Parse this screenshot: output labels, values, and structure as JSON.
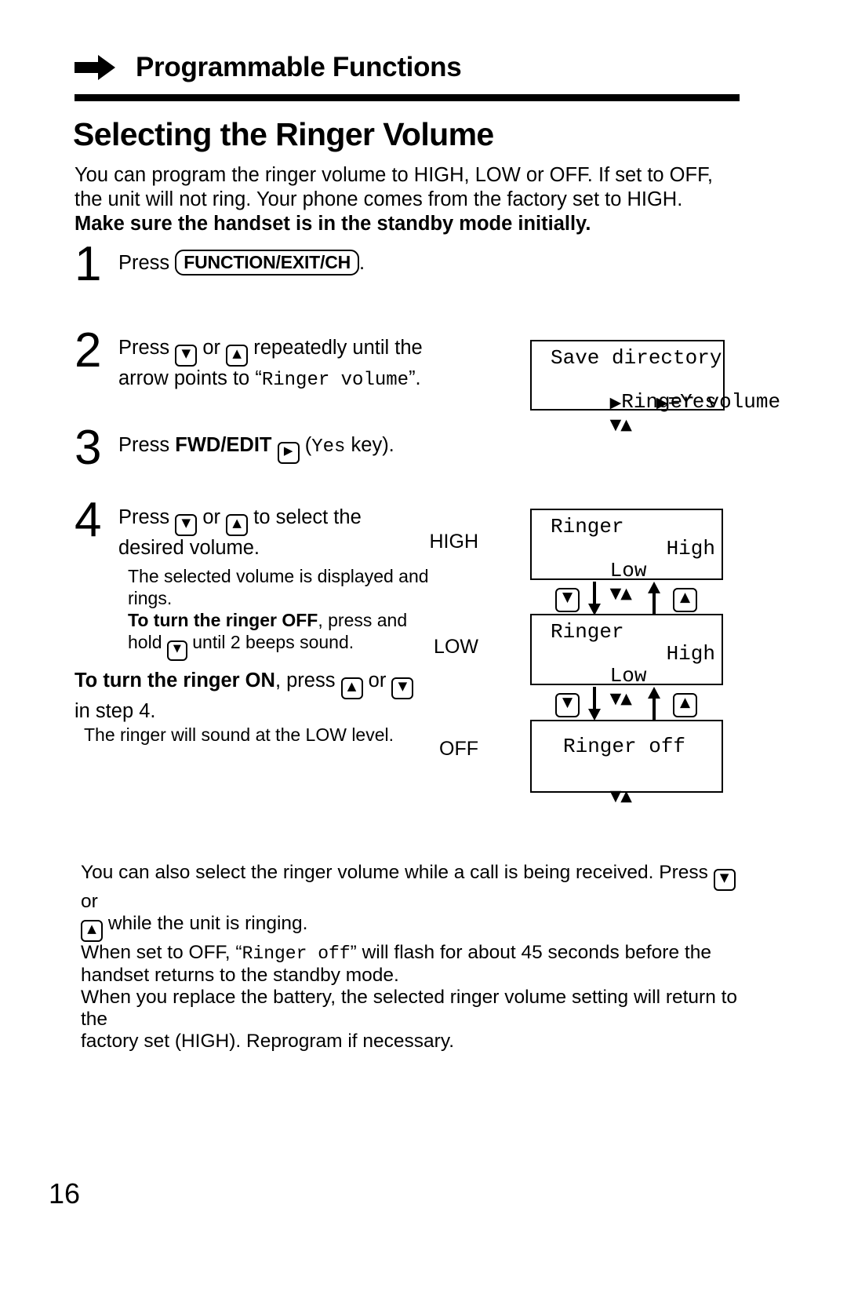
{
  "header": {
    "arrow_icon": "right-arrow-icon",
    "title": "Programmable Functions"
  },
  "section": {
    "title": "Selecting the Ringer Volume",
    "intro_line1": "You can program the ringer volume to HIGH, LOW or OFF. If set to OFF,",
    "intro_line2": "the unit will not ring. Your phone comes from the factory set to HIGH.",
    "intro_bold": "Make sure the handset is in the standby mode initially."
  },
  "steps": [
    {
      "number": "1",
      "press": "Press",
      "key_label": "FUNCTION/EXIT/CH",
      "period": "."
    },
    {
      "number": "2",
      "press": "Press",
      "or": "or",
      "text_mid": "repeatedly until the",
      "text_line2a": "arrow points to “",
      "mono": "Ringer volume",
      "text_line2b": "”.",
      "key_down": "▼",
      "key_up": "▲"
    },
    {
      "number": "3",
      "press": "Press",
      "bold_label": "FWD/EDIT",
      "key_right": "▶",
      "paren_open": "(",
      "mono": "Yes",
      "paren_close": " key)."
    },
    {
      "number": "4",
      "press": "Press",
      "or": "or",
      "text_mid": "to select the",
      "text_line2": "desired volume.",
      "key_down": "▼",
      "key_up": "▲",
      "sub_line1": "The selected volume is displayed and",
      "sub_line2": "rings.",
      "sub_bold": "To turn the ringer OFF",
      "sub_line3": ", press and",
      "sub_line4a": "hold",
      "sub_line4b": "until 2 beeps sound."
    }
  ],
  "turn_on": {
    "bold": "To turn the ringer ON",
    "text1": ", press",
    "or": "or",
    "key_up": "▲",
    "key_down": "▼",
    "line2": "in step 4.",
    "note": "The ringer will sound at the LOW level."
  },
  "lcd_step2": {
    "line1": "Save directory",
    "line2_arrow": "▶",
    "line2": "Ringer volume",
    "line3_arrows": "▼▲",
    "line3_right_arrow": "▶",
    "line3_right": "=Yes"
  },
  "flow": {
    "label_high": "HIGH",
    "label_low": "LOW",
    "label_off": "OFF",
    "lcd_high": {
      "line1": "Ringer",
      "line2_left": "Low",
      "line2_right": "High",
      "line3_arrows": "▼▲"
    },
    "lcd_low": {
      "line1": "Ringer",
      "line2_left": "Low",
      "line2_right": "High",
      "line3_arrows": "▼▲"
    },
    "lcd_off": {
      "line1": "Ringer off",
      "line2_arrows": "▼▲"
    },
    "key_down": "▼",
    "key_up": "▲"
  },
  "notes": {
    "line1a": "You can also select the ringer volume while a call is being received. Press",
    "line1_key_down": "▼",
    "line1b": "or",
    "line2_key_up": "▲",
    "line2": "while the unit is ringing.",
    "line3a": "When set to OFF, “",
    "line3_mono": "Ringer off",
    "line3b": "” will flash for about 45 seconds before the",
    "line4": "handset returns to the standby mode.",
    "line5": "When you replace the battery, the selected ringer volume setting will return to the",
    "line6": "factory set (HIGH). Reprogram if necessary."
  },
  "page_number": "16",
  "colors": {
    "ink": "#000000",
    "paper": "#ffffff"
  }
}
